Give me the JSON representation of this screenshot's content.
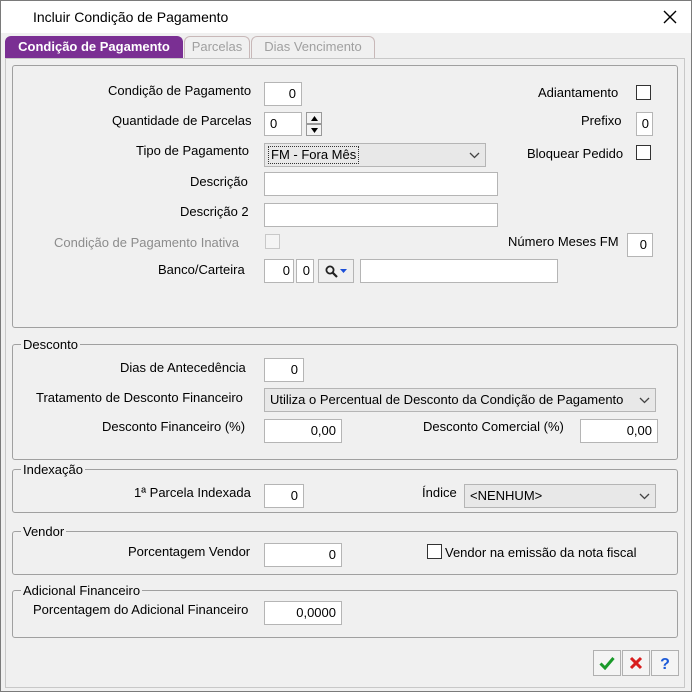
{
  "window": {
    "title": "Incluir Condição de Pagamento"
  },
  "tabs": [
    {
      "label": "Condição de Pagamento",
      "active": true
    },
    {
      "label": "Parcelas",
      "active": false
    },
    {
      "label": "Dias Vencimento",
      "active": false
    }
  ],
  "main": {
    "condicao_label": "Condição de Pagamento",
    "condicao_value": "0",
    "qtd_parcelas_label": "Quantidade de Parcelas",
    "qtd_parcelas_value": "0",
    "tipo_pagamento_label": "Tipo de Pagamento",
    "tipo_pagamento_value": "FM - Fora Mês",
    "descricao_label": "Descrição",
    "descricao_value": "",
    "descricao2_label": "Descrição 2",
    "descricao2_value": "",
    "inativa_label": "Condição de Pagamento Inativa",
    "banco_label": "Banco/Carteira",
    "banco_value": "0",
    "carteira_value": "0",
    "banco_desc_value": "",
    "adiantamento_label": "Adiantamento",
    "prefixo_label": "Prefixo",
    "prefixo_value": "0",
    "bloquear_label": "Bloquear Pedido",
    "meses_fm_label": "Número Meses FM",
    "meses_fm_value": "0"
  },
  "desconto": {
    "group_label": "Desconto",
    "dias_label": "Dias de Antecedência",
    "dias_value": "0",
    "tratamento_label": "Tratamento de Desconto Financeiro",
    "tratamento_value": "Utiliza o Percentual de Desconto da Condição de Pagamento",
    "financeiro_label": "Desconto Financeiro (%)",
    "financeiro_value": "0,00",
    "comercial_label": "Desconto  Comercial (%)",
    "comercial_value": "0,00"
  },
  "indexacao": {
    "group_label": "Indexação",
    "parcela_label": "1ª Parcela Indexada",
    "parcela_value": "0",
    "indice_label": "Índice",
    "indice_value": "<NENHUM>"
  },
  "vendor": {
    "group_label": "Vendor",
    "porcentagem_label": "Porcentagem Vendor",
    "porcentagem_value": "0",
    "emissao_label": "Vendor na emissão da nota fiscal"
  },
  "adicional": {
    "group_label": "Adicional Financeiro",
    "porcentagem_label": "Porcentagem do Adicional Financeiro",
    "porcentagem_value": "0,0000"
  },
  "icons": {
    "app": "window-icon",
    "close": "close-icon",
    "confirm": "checkmark-icon",
    "cancel": "x-icon",
    "help": "question-icon",
    "search": "magnifier-icon"
  },
  "colors": {
    "active_tab": "#7a2f93",
    "confirm": "#1a9a2a",
    "cancel": "#d81e1e",
    "help": "#1c5ad8"
  }
}
